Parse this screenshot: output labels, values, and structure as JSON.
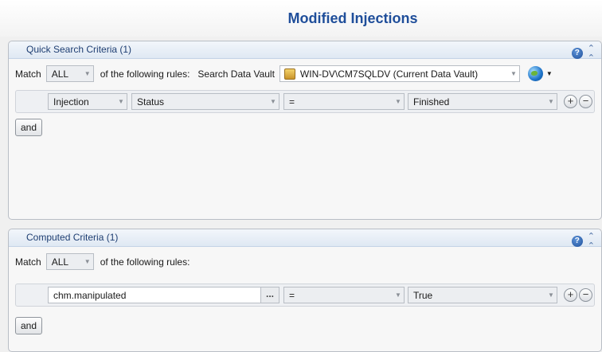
{
  "title": "Modified Injections",
  "quick": {
    "header": "Quick Search Criteria (1)",
    "match_label": "Match",
    "match_value": "ALL",
    "rules_text": "of the following rules:",
    "vault_label": "Search Data Vault",
    "vault_value": "WIN-DV\\CM7SQLDV (Current Data Vault)",
    "rule": {
      "field1": "Injection",
      "field2": "Status",
      "operator": "=",
      "value": "Finished"
    },
    "and_label": "and"
  },
  "computed": {
    "header": "Computed Criteria (1)",
    "match_label": "Match",
    "match_value": "ALL",
    "rules_text": "of the following rules:",
    "rule": {
      "expression": "chm.manipulated",
      "browse": "...",
      "operator": "=",
      "value": "True"
    },
    "and_label": "and"
  },
  "icons": {
    "help": "?",
    "collapse": "«",
    "add": "+",
    "remove": "−",
    "dropdown": "▼"
  }
}
